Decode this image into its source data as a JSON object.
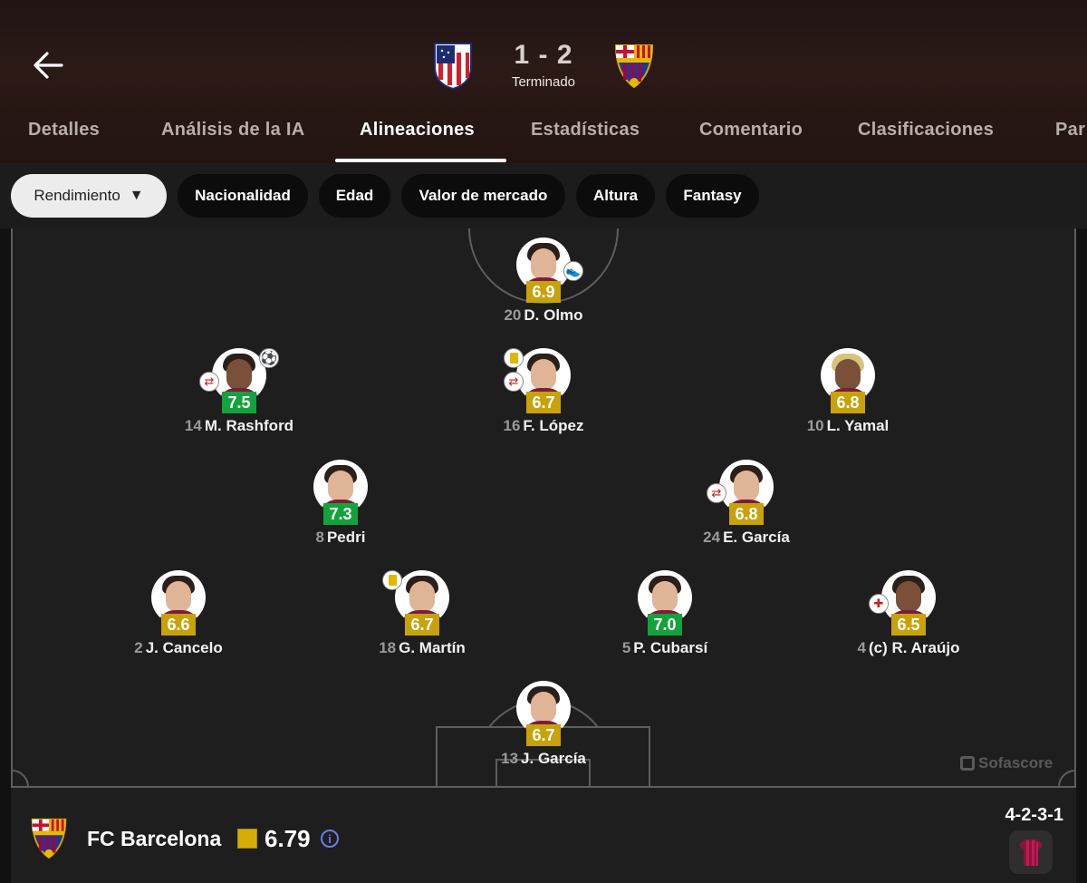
{
  "match": {
    "home_team": "Atlético de Madrid",
    "away_team": "FC Barcelona",
    "score": "1 - 2",
    "status": "Terminado"
  },
  "tabs": [
    {
      "label": "Detalles"
    },
    {
      "label": "Análisis de la IA"
    },
    {
      "label": "Alineaciones",
      "active": true
    },
    {
      "label": "Estadísticas"
    },
    {
      "label": "Comentario"
    },
    {
      "label": "Clasificaciones"
    },
    {
      "label": "Par"
    }
  ],
  "filters": [
    {
      "label": "Rendimiento",
      "selected": true
    },
    {
      "label": "Nacionalidad"
    },
    {
      "label": "Edad"
    },
    {
      "label": "Valor de mercado"
    },
    {
      "label": "Altura"
    },
    {
      "label": "Fantasy"
    }
  ],
  "players": {
    "olmo": {
      "number": "20",
      "name": "D. Olmo",
      "rating": "6.9"
    },
    "rashford": {
      "number": "14",
      "name": "M. Rashford",
      "rating": "7.5"
    },
    "lopez": {
      "number": "16",
      "name": "F. López",
      "rating": "6.7"
    },
    "yamal": {
      "number": "10",
      "name": "L. Yamal",
      "rating": "6.8"
    },
    "pedri": {
      "number": "8",
      "name": "Pedri",
      "rating": "7.3"
    },
    "egarcia": {
      "number": "24",
      "name": "E. García",
      "rating": "6.8"
    },
    "cancelo": {
      "number": "2",
      "name": "J. Cancelo",
      "rating": "6.6"
    },
    "martin": {
      "number": "18",
      "name": "G. Martín",
      "rating": "6.7"
    },
    "cubarsi": {
      "number": "5",
      "name": "P. Cubarsí",
      "rating": "7.0"
    },
    "araujo": {
      "number": "4",
      "name": "(c) R. Araújo",
      "rating": "6.5"
    },
    "jgarcia": {
      "number": "13",
      "name": "J. García",
      "rating": "6.7"
    }
  },
  "watermark": "Sofascore",
  "team_summary": {
    "name": "FC Barcelona",
    "avg_rating": "6.79",
    "formation": "4-2-3-1",
    "info_icon": "i"
  },
  "colors": {
    "rating_green": "#14a23c",
    "rating_yellow": "#c8a20a",
    "team_rating_box": "#d6ad06",
    "info_accent": "#6c7ce6"
  },
  "icons": {
    "back": "arrow-left-icon",
    "caret": "▼",
    "substitution": "substitution-icon",
    "yellow_card": "yellow-card-icon",
    "goal": "soccer-ball-icon",
    "assist": "boot-icon",
    "injury": "injury-cross-icon",
    "kit": "shirt-icon"
  }
}
